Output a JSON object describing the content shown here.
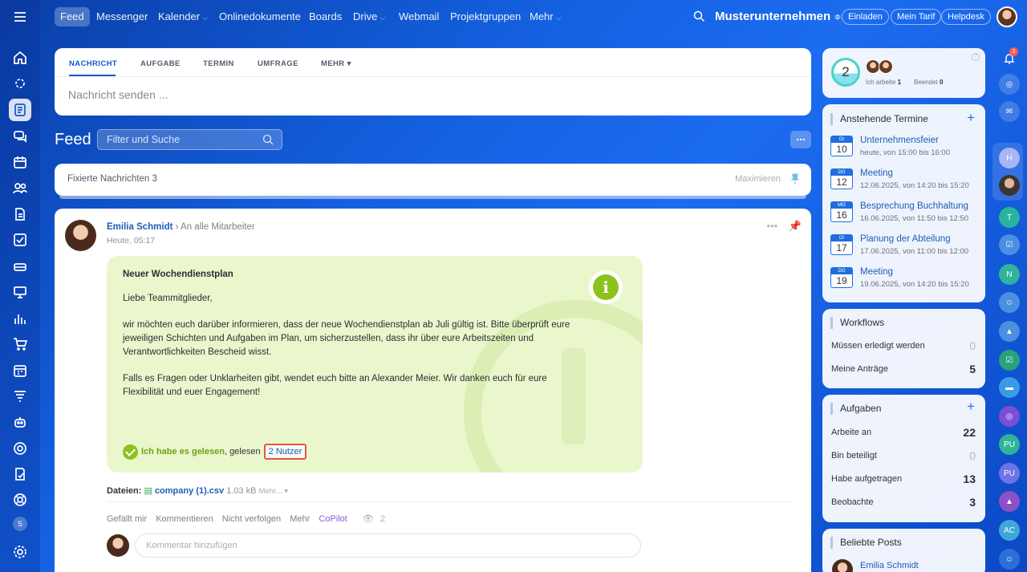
{
  "topnav": {
    "items": [
      "Feed",
      "Messenger",
      "Kalender",
      "Onlinedokumente",
      "Boards",
      "Drive",
      "Webmail",
      "Projektgruppen",
      "Mehr"
    ],
    "company": "Musterunternehmen",
    "buttons": [
      "Einladen",
      "Mein Tarif",
      "Helpdesk"
    ]
  },
  "composer": {
    "tabs": [
      "NACHRICHT",
      "AUFGABE",
      "TERMIN",
      "UMFRAGE",
      "MEHR"
    ],
    "placeholder": "Nachricht senden ..."
  },
  "feed": {
    "title": "Feed",
    "search_placeholder": "Filter und Suche",
    "pinned_label": "Fixierte Nachrichten",
    "pinned_count": "3",
    "maximize": "Maximieren"
  },
  "post": {
    "author": "Emilia Schmidt",
    "recipients": "An alle Mitarbeiter",
    "time": "Heute, 05:17",
    "title": "Neuer Wochendienstplan",
    "greeting": "Liebe Teammitglieder,",
    "paragraph1": "wir möchten euch darüber informieren, dass der neue Wochendienstplan ab Juli gültig ist. Bitte überprüft eure jeweiligen Schichten und Aufgaben im Plan, um sicherzustellen, dass ihr über eure Arbeitszeiten und Verantwortlichkeiten Bescheid wisst.",
    "paragraph2": "Falls es Fragen oder Unklarheiten gibt, wendet euch bitte an Alexander Meier. Wir danken euch für eure Flexibilität und euer Engagement!",
    "read_confirm": "Ich habe es gelesen",
    "read_by": "gelesen",
    "read_users": "2 Nutzer",
    "files_label": "Dateien:",
    "file_name": "company (1).csv",
    "file_size": "1.03 kB",
    "file_more": "Mehr...",
    "actions": [
      "Gefällt mir",
      "Kommentieren",
      "Nicht verfolgen",
      "Mehr",
      "CoPilot"
    ],
    "views": "2",
    "comment_placeholder": "Kommentar hinzufügen"
  },
  "worktime": {
    "counter": "2",
    "working_label": "Ich arbeite",
    "working_value": "1",
    "done_label": "Beendet",
    "done_value": "0"
  },
  "events": {
    "title": "Anstehende Termine",
    "items": [
      {
        "dow": "DI",
        "day": "10",
        "title": "Unternehmensfeier",
        "time": "heute, von 15:00 bis 16:00"
      },
      {
        "dow": "DO",
        "day": "12",
        "title": "Meeting",
        "time": "12.06.2025, von 14:20 bis 15:20"
      },
      {
        "dow": "MO",
        "day": "16",
        "title": "Besprechung Buchhaltung",
        "time": "16.06.2025, von 11:50 bis 12:50"
      },
      {
        "dow": "DI",
        "day": "17",
        "title": "Planung der Abteilung",
        "time": "17.06.2025, von 11:00 bis 12:00"
      },
      {
        "dow": "DO",
        "day": "19",
        "title": "Meeting",
        "time": "19.06.2025, von 14:20 bis 15:20"
      }
    ]
  },
  "workflows": {
    "title": "Workflows",
    "rows": [
      {
        "label": "Müssen erledigt werden",
        "value": "0"
      },
      {
        "label": "Meine Anträge",
        "value": "5"
      }
    ]
  },
  "tasks": {
    "title": "Aufgaben",
    "rows": [
      {
        "label": "Arbeite an",
        "value": "22"
      },
      {
        "label": "Bin beteiligt",
        "value": "0"
      },
      {
        "label": "Habe aufgetragen",
        "value": "13"
      },
      {
        "label": "Beobachte",
        "value": "3"
      }
    ]
  },
  "popular": {
    "title": "Beliebte Posts",
    "author": "Emilia Schmidt"
  },
  "right_rail": {
    "notification_count": "3",
    "initials": [
      "H",
      "T",
      "N",
      "PU",
      "PU",
      "AC"
    ]
  },
  "left_rail": {
    "small_badge": "S"
  }
}
